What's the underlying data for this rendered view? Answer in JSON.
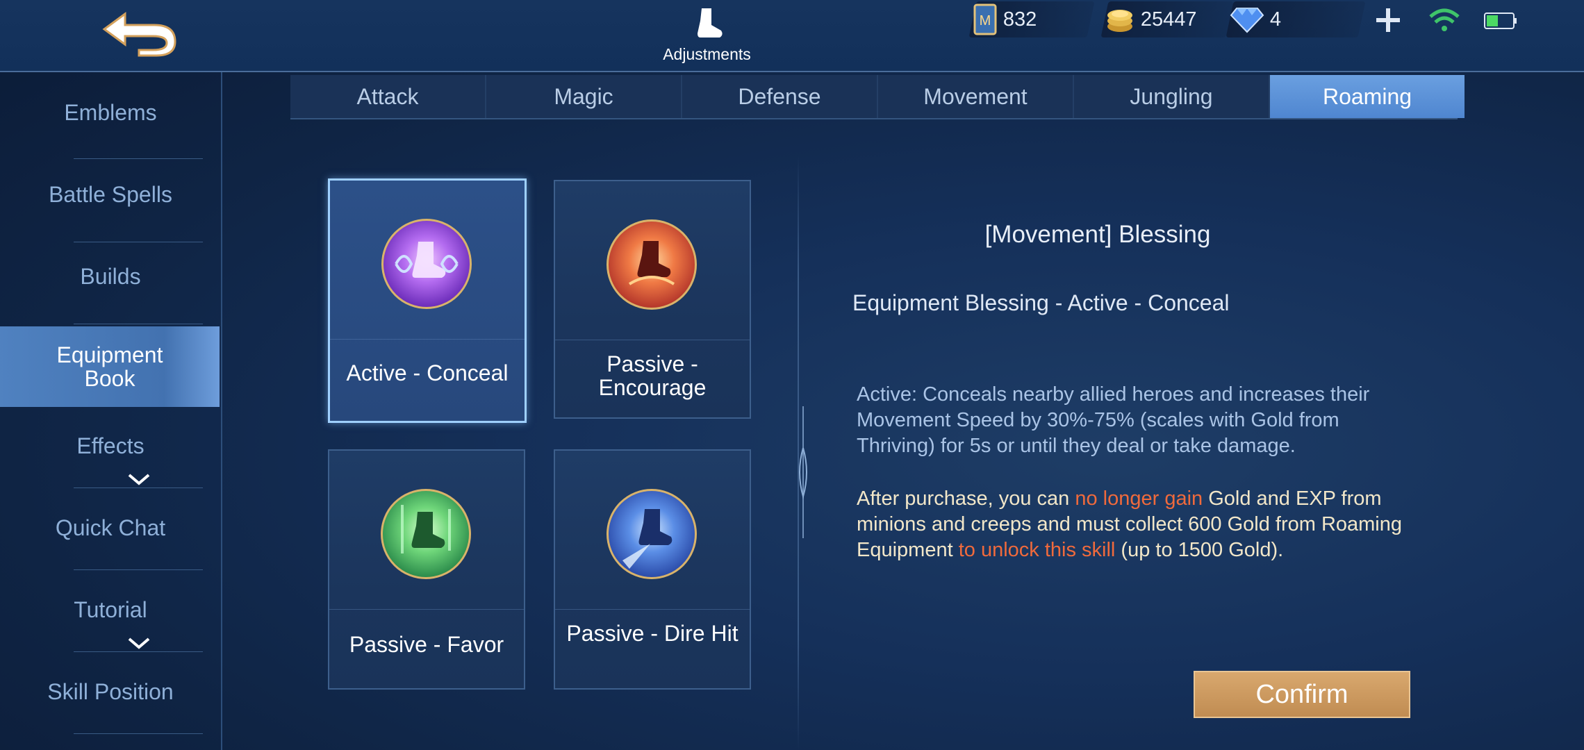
{
  "header": {
    "title": "Adjustments",
    "currencies": [
      {
        "name": "ticket",
        "icon": "ticket-icon",
        "value": "832"
      },
      {
        "name": "gold",
        "icon": "gold-coins-icon",
        "value": "25447"
      },
      {
        "name": "diamond",
        "icon": "diamond-icon",
        "value": "4"
      }
    ]
  },
  "sidebar": {
    "items": [
      {
        "label": "Emblems"
      },
      {
        "label": "Battle Spells"
      },
      {
        "label": "Builds"
      },
      {
        "label": "Equipment\nBook",
        "active": true
      },
      {
        "label": "Effects"
      },
      {
        "label": "Quick Chat"
      },
      {
        "label": "Tutorial"
      },
      {
        "label": "Skill Position"
      }
    ]
  },
  "tabs": [
    {
      "label": "Attack"
    },
    {
      "label": "Magic"
    },
    {
      "label": "Defense"
    },
    {
      "label": "Movement"
    },
    {
      "label": "Jungling"
    },
    {
      "label": "Roaming",
      "active": true
    }
  ],
  "cards": [
    {
      "label": "Active - Conceal",
      "icon": "conceal-boot-icon",
      "selected": true
    },
    {
      "label": "Passive - Encourage",
      "icon": "encourage-boot-icon"
    },
    {
      "label": "Passive - Favor",
      "icon": "favor-boot-icon"
    },
    {
      "label": "Passive - Dire Hit",
      "icon": "dire-hit-boot-icon"
    }
  ],
  "detail": {
    "title": "[Movement] Blessing",
    "subtitle": "Equipment Blessing - Active - Conceal",
    "description": "Active: Conceals nearby allied heroes and increases their Movement Speed by 30%-75% (scales with Gold from Thriving) for 5s or until they deal or take damage.",
    "note_parts": [
      {
        "text": "After purchase, you can ",
        "highlight": false
      },
      {
        "text": "no longer gain",
        "highlight": true
      },
      {
        "text": " Gold and EXP from minions and creeps and must collect 600 Gold from Roaming Equipment ",
        "highlight": false
      },
      {
        "text": "to unlock this skill",
        "highlight": true
      },
      {
        "text": " (up to 1500 Gold).",
        "highlight": false
      }
    ]
  },
  "confirm_label": "Confirm",
  "colors": {
    "accent_tab": "#5b8fd6",
    "highlight_text": "#f06a3c",
    "confirm_button": "#c99a5f"
  }
}
